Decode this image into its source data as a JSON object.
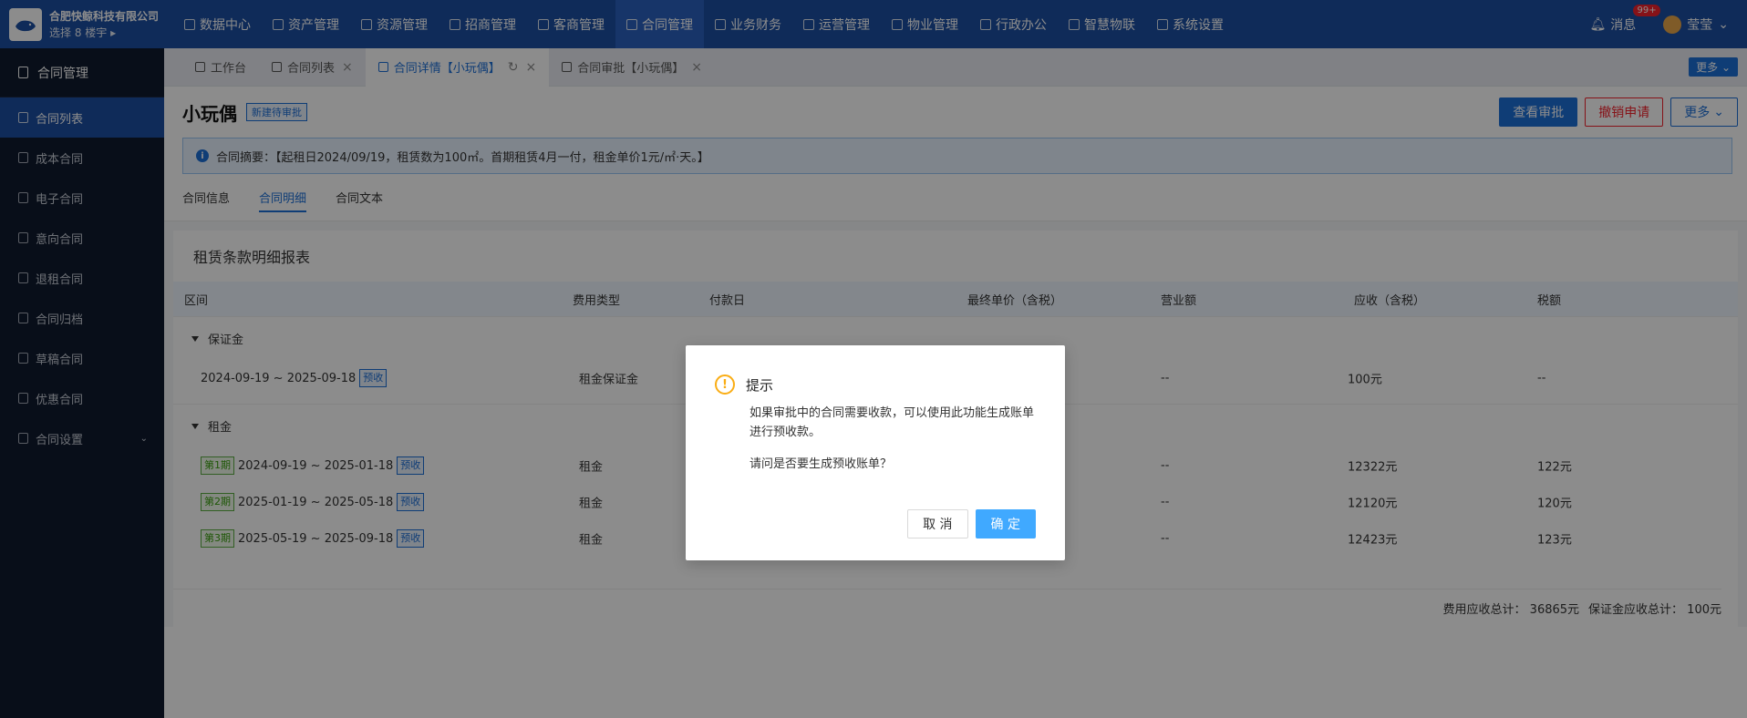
{
  "brand": {
    "name": "合肥快鲸科技有限公司",
    "building": "选择 8 楼宇 ▸"
  },
  "topnav": [
    "数据中心",
    "资产管理",
    "资源管理",
    "招商管理",
    "客商管理",
    "合同管理",
    "业务财务",
    "运营管理",
    "物业管理",
    "行政办公",
    "智慧物联",
    "系统设置"
  ],
  "topnav_active": "合同管理",
  "top_right": {
    "messages": "消息",
    "badge": "99+",
    "user": "莹莹"
  },
  "sidebar": {
    "header": "合同管理",
    "items": [
      "合同列表",
      "成本合同",
      "电子合同",
      "意向合同",
      "退租合同",
      "合同归档",
      "草稿合同",
      "优惠合同",
      "合同设置"
    ]
  },
  "tabs": {
    "t0": "工作台",
    "t1": "合同列表",
    "t2": "合同详情【小玩偶】",
    "t3": "合同审批【小玩偶】",
    "more": "更多"
  },
  "page": {
    "title": "小玩偶",
    "status": "新建待审批",
    "btn_view": "查看审批",
    "btn_revoke": "撤销申请",
    "btn_more": "更多",
    "summary": "合同摘要：【起租日2024/09/19，租赁数为100㎡。首期租赁4月一付，租金单价1元/㎡·天。】"
  },
  "subtabs": [
    "合同信息",
    "合同明细",
    "合同文本"
  ],
  "report": {
    "title": "租赁条款明细报表",
    "headers": [
      "区间",
      "费用类型",
      "付款日",
      "最终单价（含税）",
      "营业额",
      "应收（含税）",
      "税额"
    ],
    "groups": {
      "deposit": {
        "name": "保证金",
        "row": {
          "range": "2024-09-19 ~ 2025-09-18",
          "tag": "预收",
          "type": "租金保证金",
          "turnover": "--",
          "receivable": "100元",
          "tax": "--"
        }
      },
      "rent": {
        "name": "租金",
        "rows": [
          {
            "period": "第1期",
            "range": "2024-09-19 ~ 2025-01-18",
            "tag": "预收",
            "type": "租金",
            "turnover": "--",
            "receivable": "12322元",
            "tax": "122元"
          },
          {
            "period": "第2期",
            "range": "2025-01-19 ~ 2025-05-18",
            "tag": "预收",
            "type": "租金",
            "turnover": "--",
            "receivable": "12120元",
            "tax": "120元"
          },
          {
            "period": "第3期",
            "range": "2025-05-19 ~ 2025-09-18",
            "tag": "预收",
            "type": "租金",
            "turnover": "--",
            "receivable": "12423元",
            "tax": "123元"
          }
        ]
      }
    },
    "totals": {
      "fee": "费用应收总计：  36865元",
      "deposit": "保证金应收总计：  100元"
    }
  },
  "dialog": {
    "title": "提示",
    "body": "如果审批中的合同需要收款，可以使用此功能生成账单进行预收款。",
    "question": "请问是否要生成预收账单？",
    "cancel": "取 消",
    "ok": "确 定"
  }
}
